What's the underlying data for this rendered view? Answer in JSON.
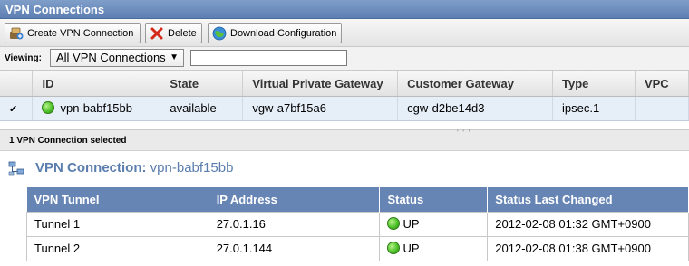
{
  "window": {
    "title": "VPN Connections"
  },
  "toolbar": {
    "create_label": "Create VPN Connection",
    "delete_label": "Delete",
    "download_label": "Download Configuration"
  },
  "filter": {
    "viewing_label": "Viewing:",
    "selected": "All VPN Connections",
    "search_value": ""
  },
  "grid": {
    "columns": [
      "ID",
      "State",
      "Virtual Private Gateway",
      "Customer Gateway",
      "Type",
      "VPC"
    ],
    "rows": [
      {
        "checked": "✔",
        "id": "vpn-babf15bb",
        "state": "available",
        "vgw": "vgw-a7bf15a6",
        "cgw": "cgw-d2be14d3",
        "type": "ipsec.1",
        "vpc": ""
      }
    ]
  },
  "selection": {
    "text": "1 VPN Connection selected",
    "grip": "' ' '"
  },
  "detail": {
    "title_prefix": "VPN Connection:",
    "title_id": "vpn-babf15bb",
    "columns": [
      "VPN Tunnel",
      "IP Address",
      "Status",
      "Status Last Changed"
    ],
    "tunnels": [
      {
        "name": "Tunnel 1",
        "ip": "27.0.1.16",
        "status": "UP",
        "changed": "2012-02-08 01:32 GMT+0900"
      },
      {
        "name": "Tunnel 2",
        "ip": "27.0.1.144",
        "status": "UP",
        "changed": "2012-02-08 01:38 GMT+0900"
      }
    ]
  },
  "colors": {
    "header_blue": "#5d7fb3",
    "selected_row": "#e6eef8",
    "status_green": "#4fc22a"
  },
  "icons": [
    "create-vpn-icon",
    "delete-icon",
    "download-icon",
    "status-green-icon",
    "network-icon",
    "dropdown-arrow-icon"
  ]
}
